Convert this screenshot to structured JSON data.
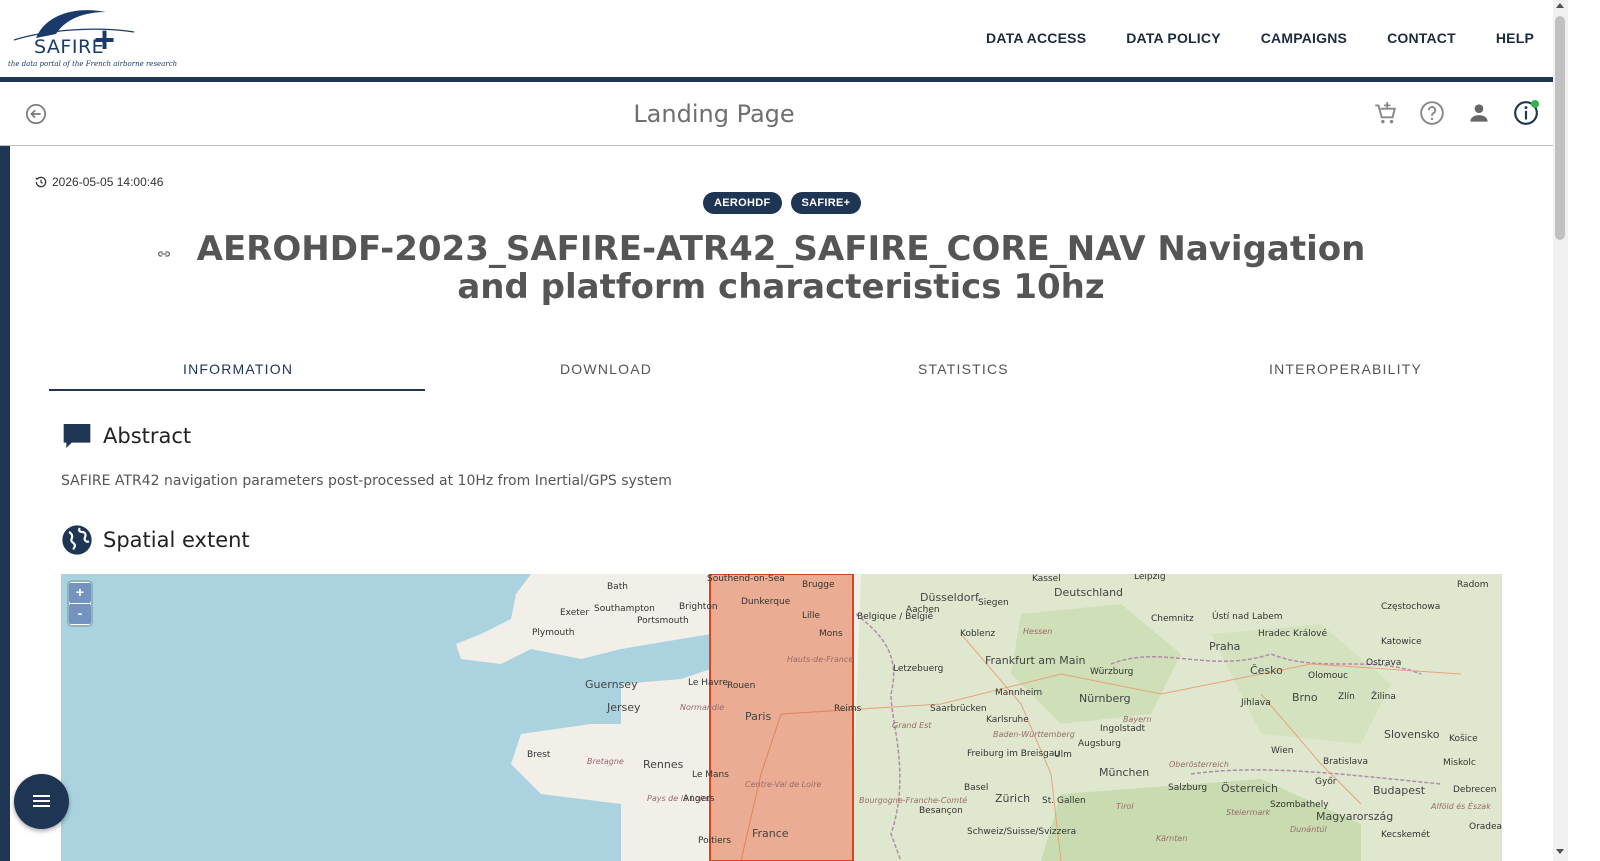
{
  "header": {
    "logo_text": "SAFIRE",
    "logo_plus": "+",
    "logo_tagline": "the data portal of the French airborne research",
    "nav": [
      "DATA ACCESS",
      "DATA POLICY",
      "CAMPAIGNS",
      "CONTACT",
      "HELP"
    ]
  },
  "subbar": {
    "title": "Landing Page",
    "icons": [
      "back-icon",
      "cart-icon",
      "help-icon",
      "user-icon",
      "info-icon"
    ]
  },
  "dataset": {
    "timestamp": "2026-05-05 14:00:46",
    "badges": [
      "AEROHDF",
      "SAFIRE+"
    ],
    "title": "AEROHDF-2023_SAFIRE-ATR42_SAFIRE_CORE_NAV Navigation and platform characteristics 10hz"
  },
  "tabs": [
    "INFORMATION",
    "DOWNLOAD",
    "STATISTICS",
    "INTEROPERABILITY"
  ],
  "active_tab": "INFORMATION",
  "abstract": {
    "heading": "Abstract",
    "text": "SAFIRE ATR42 navigation parameters post-processed at 10Hz from Inertial/GPS system"
  },
  "spatial": {
    "heading": "Spatial extent",
    "zoom_in": "+",
    "zoom_out": "-",
    "labels": [
      "Bath",
      "Southend-on-Sea",
      "Brugge",
      "Exeter",
      "Southampton",
      "Brighton",
      "Plymouth",
      "Portsmouth",
      "Dunkerque",
      "Lille",
      "Mons",
      "Guernsey",
      "Jersey",
      "Le Havre",
      "Rouen",
      "Paris",
      "Reims",
      "Normandie",
      "Hauts-de-France",
      "Brest",
      "Bretagne",
      "Rennes",
      "Le Mans",
      "Pays de la Loire",
      "Angers",
      "Centre-Val de Loire",
      "France",
      "Poitiers",
      "Kassel",
      "Leipzig",
      "Deutschland",
      "Aachen",
      "Düsseldorf",
      "Siegen",
      "Koblenz",
      "Frankfurt am Main",
      "Würzburg",
      "Chemnitz",
      "Hessen",
      "Praha",
      "Ústí nad Labem",
      "Hradec Králové",
      "Česko",
      "Katowice",
      "Ostrava",
      "Olomouc",
      "Brno",
      "Zlín",
      "Žilina",
      "Belgique / België",
      "Letzebuerg",
      "Mannheim",
      "Nürnberg",
      "Saarbrücken",
      "Karlsruhe",
      "Ingolstadt",
      "Augsburg",
      "Grand Est",
      "Baden-Württemberg",
      "Bayern",
      "Jihlava",
      "Slovensko",
      "Košice",
      "Wien",
      "Bratislava",
      "Freiburg im Breisgau",
      "Ulm",
      "München",
      "Oberösterreich",
      "Salzburg",
      "Österreich",
      "Győr",
      "Budapest",
      "Basel",
      "Zürich",
      "St. Gallen",
      "Tirol",
      "Magyarország",
      "Besançon",
      "Bourgogne-Franche-Comté",
      "Schweiz/Suisse/Svizzera",
      "Debrecen",
      "Kecskemét",
      "Szombathely",
      "Miskolc",
      "Radom",
      "Częstochowa",
      "Kärnten",
      "Steiermark",
      "Dunántúl",
      "Alföld és Észak",
      "Oradea"
    ],
    "bbox_color": "#e05a2a"
  },
  "fab": {
    "icon": "menu-icon"
  }
}
